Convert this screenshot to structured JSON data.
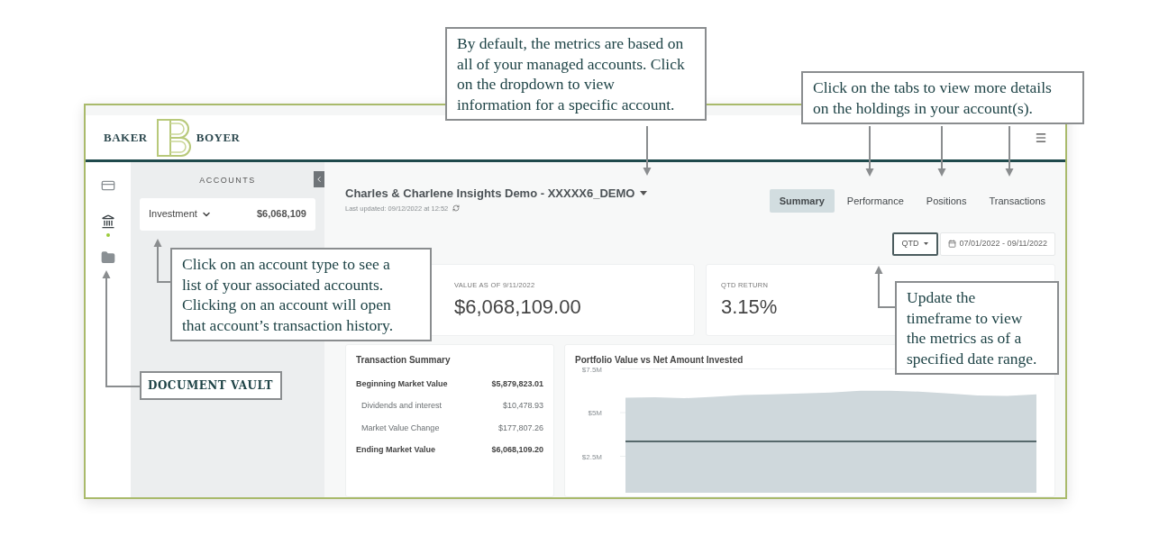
{
  "logo": {
    "left": "BAKER",
    "right": "BOYER"
  },
  "rail_items": [
    {
      "kind": "card",
      "selected": false
    },
    {
      "kind": "bank",
      "selected": true
    },
    {
      "kind": "folder",
      "selected": false
    }
  ],
  "accounts_panel": {
    "title": "ACCOUNTS",
    "accounts": [
      {
        "label": "Investment",
        "value": "$6,068,109"
      }
    ]
  },
  "account_title": "Charles & Charlene Insights Demo - XXXXX6_DEMO",
  "last_updated": "Last updated: 09/12/2022 at 12:52",
  "tabs": [
    {
      "label": "Summary",
      "selected": true
    },
    {
      "label": "Performance",
      "selected": false
    },
    {
      "label": "Positions",
      "selected": false
    },
    {
      "label": "Transactions",
      "selected": false
    }
  ],
  "period": "QTD",
  "date_range": "07/01/2022 - 09/11/2022",
  "metrics": [
    {
      "label": "VALUE AS OF 9/11/2022",
      "value": "$6,068,109.00"
    },
    {
      "label": "QTD RETURN",
      "value": "3.15%"
    }
  ],
  "transaction_summary": {
    "title": "Transaction Summary",
    "rows": [
      {
        "kind": "total",
        "label": "Beginning Market Value",
        "value": "$5,879,823.01"
      },
      {
        "kind": "detail",
        "label": "Dividends and interest",
        "value": "$10,478.93"
      },
      {
        "kind": "detail",
        "label": "Market Value Change",
        "value": "$177,807.26"
      },
      {
        "kind": "total",
        "label": "Ending Market Value",
        "value": "$6,068,109.20"
      }
    ]
  },
  "chart": {
    "title": "Portfolio Value vs Net Amount Invested",
    "chart_data": {
      "type": "area",
      "ylim": [
        0,
        7.5
      ],
      "yticks": [
        {
          "value": 2.5,
          "label": "$2.5M"
        },
        {
          "value": 5,
          "label": "$5M"
        },
        {
          "value": 7.5,
          "label": "$7.5M"
        }
      ],
      "series": [
        {
          "color": "#cfd8dc",
          "values": [
            5.85,
            5.88,
            5.82,
            5.9,
            6.0,
            6.05,
            6.1,
            6.15,
            6.25,
            6.25,
            6.2,
            6.1,
            5.98,
            5.95,
            6.05
          ]
        },
        {
          "type": "line",
          "color": "#2f4447",
          "values": [
            3.35,
            3.35,
            3.35,
            3.35,
            3.35,
            3.35,
            3.35,
            3.35,
            3.35,
            3.35,
            3.35,
            3.35,
            3.35,
            3.35,
            3.35
          ]
        }
      ]
    }
  },
  "callouts": [
    {
      "kind": "note",
      "text": "By default, the metrics are based on all of your managed accounts. Click on the dropdown to view information for a specific account."
    },
    {
      "kind": "note",
      "text": "Click on the tabs to view more details on the holdings in your account(s)."
    },
    {
      "kind": "note",
      "text": "Click on an account type to see a list of your associated accounts. Clicking on an account will open that account’s transaction history."
    },
    {
      "kind": "label",
      "text": "DOCUMENT VAULT"
    },
    {
      "kind": "note",
      "text": "Update the timeframe to view the metrics as of a specified date range."
    }
  ]
}
